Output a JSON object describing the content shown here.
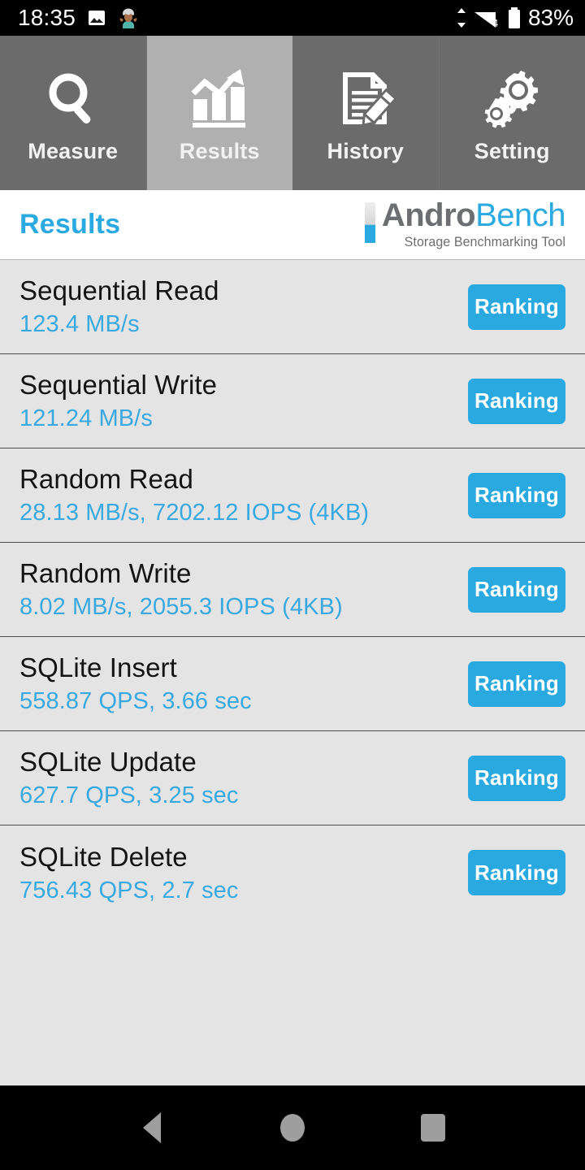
{
  "statusbar": {
    "time": "18:35",
    "icons_left": [
      "image-icon",
      "emoji-notification-icon"
    ],
    "icons_right": [
      "data-transfer-icon",
      "signal-wifi-4-icon",
      "battery-icon"
    ],
    "signal_level": "4",
    "battery_percent": "83%"
  },
  "tabs": [
    {
      "label": "Measure",
      "icon": "magnifier-icon",
      "active": false
    },
    {
      "label": "Results",
      "icon": "bar-chart-arrow-icon",
      "active": true
    },
    {
      "label": "History",
      "icon": "document-pencil-icon",
      "active": false
    },
    {
      "label": "Setting",
      "icon": "gears-icon",
      "active": false
    }
  ],
  "header": {
    "title": "Results",
    "logo_primary": "Andro",
    "logo_secondary": "Bench",
    "logo_tagline": "Storage Benchmarking Tool"
  },
  "results": {
    "ranking_label": "Ranking",
    "rows": [
      {
        "title": "Sequential Read",
        "value": "123.4 MB/s"
      },
      {
        "title": "Sequential Write",
        "value": "121.24 MB/s"
      },
      {
        "title": "Random Read",
        "value": "28.13 MB/s, 7202.12 IOPS (4KB)"
      },
      {
        "title": "Random Write",
        "value": "8.02 MB/s, 2055.3 IOPS (4KB)"
      },
      {
        "title": "SQLite Insert",
        "value": "558.87 QPS, 3.66 sec"
      },
      {
        "title": "SQLite Update",
        "value": "627.7 QPS, 3.25 sec"
      },
      {
        "title": "SQLite Delete",
        "value": "756.43 QPS, 2.7 sec"
      }
    ]
  },
  "navbar": {
    "back": "back-icon",
    "home": "home-icon",
    "recents": "recents-icon"
  },
  "colors": {
    "accent_blue": "#2aa9e0",
    "value_blue": "#3aa9e0",
    "tab_inactive": "#6b6b6b",
    "tab_active": "#b0b0b0",
    "list_bg": "#e4e4e4",
    "logo_gray": "#6d6e71"
  }
}
